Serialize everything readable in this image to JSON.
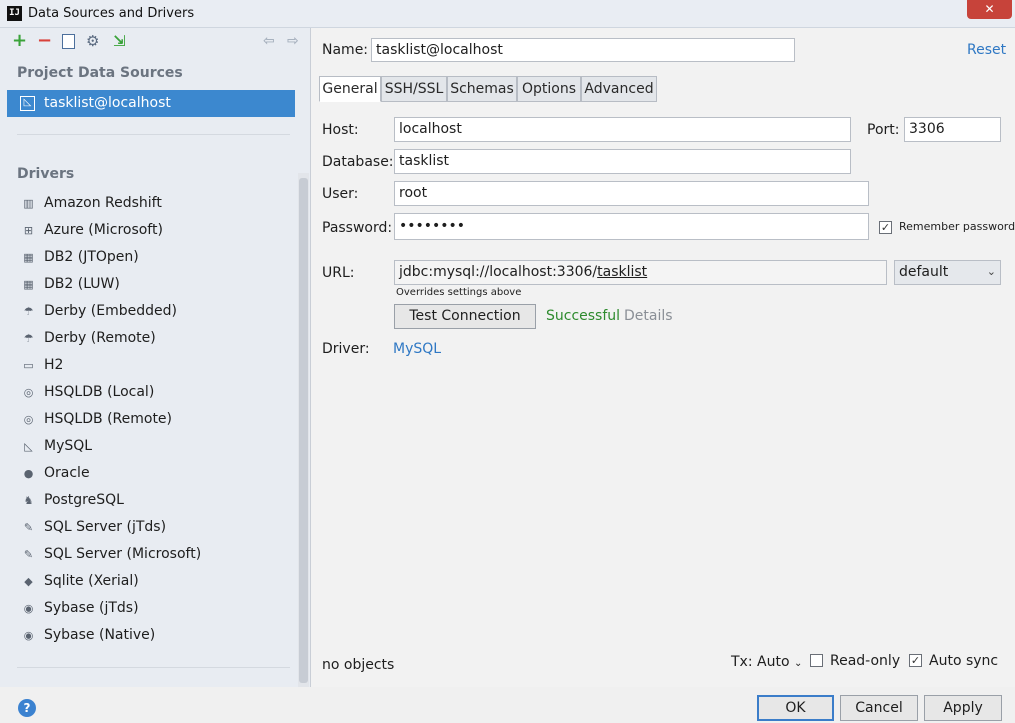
{
  "window": {
    "title": "Data Sources and Drivers",
    "app_icon": "IJ"
  },
  "toolbar": {
    "icons": [
      "add-icon",
      "remove-icon",
      "copy-icon",
      "settings-icon",
      "import-icon",
      "back-arrow-icon",
      "forward-arrow-icon"
    ]
  },
  "sidebar": {
    "project_header": "Project Data Sources",
    "selected_source": "tasklist@localhost",
    "drivers_header": "Drivers",
    "drivers": [
      {
        "label": "Amazon Redshift",
        "icon": "redshift-icon"
      },
      {
        "label": "Azure (Microsoft)",
        "icon": "azure-icon"
      },
      {
        "label": "DB2 (JTOpen)",
        "icon": "db2-icon"
      },
      {
        "label": "DB2 (LUW)",
        "icon": "db2-icon"
      },
      {
        "label": "Derby (Embedded)",
        "icon": "derby-icon"
      },
      {
        "label": "Derby (Remote)",
        "icon": "derby-icon"
      },
      {
        "label": "H2",
        "icon": "h2-icon"
      },
      {
        "label": "HSQLDB (Local)",
        "icon": "hsqldb-icon"
      },
      {
        "label": "HSQLDB (Remote)",
        "icon": "hsqldb-icon"
      },
      {
        "label": "MySQL",
        "icon": "mysql-icon"
      },
      {
        "label": "Oracle",
        "icon": "oracle-icon"
      },
      {
        "label": "PostgreSQL",
        "icon": "postgresql-icon"
      },
      {
        "label": "SQL Server (jTds)",
        "icon": "sqlserver-icon"
      },
      {
        "label": "SQL Server (Microsoft)",
        "icon": "sqlserver-icon"
      },
      {
        "label": "Sqlite (Xerial)",
        "icon": "sqlite-icon"
      },
      {
        "label": "Sybase (jTds)",
        "icon": "sybase-icon"
      },
      {
        "label": "Sybase (Native)",
        "icon": "sybase-icon"
      }
    ]
  },
  "form": {
    "name_label": "Name:",
    "name_value": "tasklist@localhost",
    "reset_label": "Reset",
    "tabs": [
      "General",
      "SSH/SSL",
      "Schemas",
      "Options",
      "Advanced"
    ],
    "active_tab": "General",
    "host_label": "Host:",
    "host_value": "localhost",
    "port_label": "Port:",
    "port_value": "3306",
    "database_label": "Database:",
    "database_value": "tasklist",
    "user_label": "User:",
    "user_value": "root",
    "password_label": "Password:",
    "password_value": "••••••••",
    "remember_password_label": "Remember password",
    "remember_password_checked": true,
    "url_label": "URL:",
    "url_prefix": "jdbc:mysql://localhost:3306/",
    "url_db": "tasklist",
    "url_mode": "default",
    "url_hint": "Overrides settings above",
    "test_connection_label": "Test Connection",
    "test_status": "Successful",
    "details_label": "Details",
    "driver_label": "Driver:",
    "driver_value": "MySQL"
  },
  "footer": {
    "objects_text": "no objects",
    "tx_label": "Tx: Auto",
    "readonly_label": "Read-only",
    "readonly_checked": false,
    "autosync_label": "Auto sync",
    "autosync_checked": true,
    "ok_label": "OK",
    "cancel_label": "Cancel",
    "apply_label": "Apply",
    "help_label": "?"
  },
  "colors": {
    "accent": "#3c88cf",
    "link": "#2f78c4",
    "success": "#2e8b2e",
    "muted": "#8a8f96"
  }
}
